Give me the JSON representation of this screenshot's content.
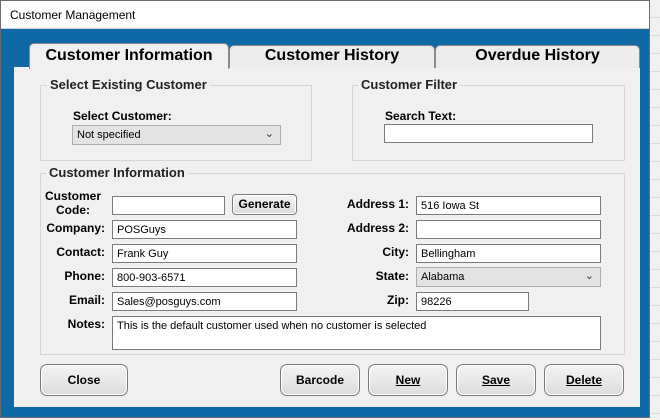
{
  "window": {
    "title": "Customer Management"
  },
  "tabs": [
    {
      "label": "Customer Information",
      "active": true
    },
    {
      "label": "Customer History",
      "active": false
    },
    {
      "label": "Overdue History",
      "active": false
    }
  ],
  "select_existing": {
    "title": "Select Existing Customer",
    "label": "Select Customer:",
    "value": "Not specified"
  },
  "filter": {
    "title": "Customer Filter",
    "label": "Search Text:",
    "value": ""
  },
  "info": {
    "title": "Customer Information",
    "code_label_1": "Customer",
    "code_label_2": "Code:",
    "code_value": "",
    "generate_label": "Generate",
    "company_label": "Company:",
    "company_value": "POSGuys",
    "contact_label": "Contact:",
    "contact_value": "Frank Guy",
    "phone_label": "Phone:",
    "phone_value": "800-903-6571",
    "email_label": "Email:",
    "email_value": "Sales@posguys.com",
    "notes_label": "Notes:",
    "notes_value": "This is the default customer used when no customer is selected",
    "address1_label": "Address 1:",
    "address1_value": "516 Iowa St",
    "address2_label": "Address 2:",
    "address2_value": "",
    "city_label": "City:",
    "city_value": "Bellingham",
    "state_label": "State:",
    "state_value": "Alabama",
    "zip_label": "Zip:",
    "zip_value": "98226"
  },
  "buttons": {
    "close": "Close",
    "barcode": "Barcode",
    "new": "New",
    "save": "Save",
    "delete": "Delete"
  },
  "icons": {
    "dropdown": "chevron-down-icon"
  }
}
